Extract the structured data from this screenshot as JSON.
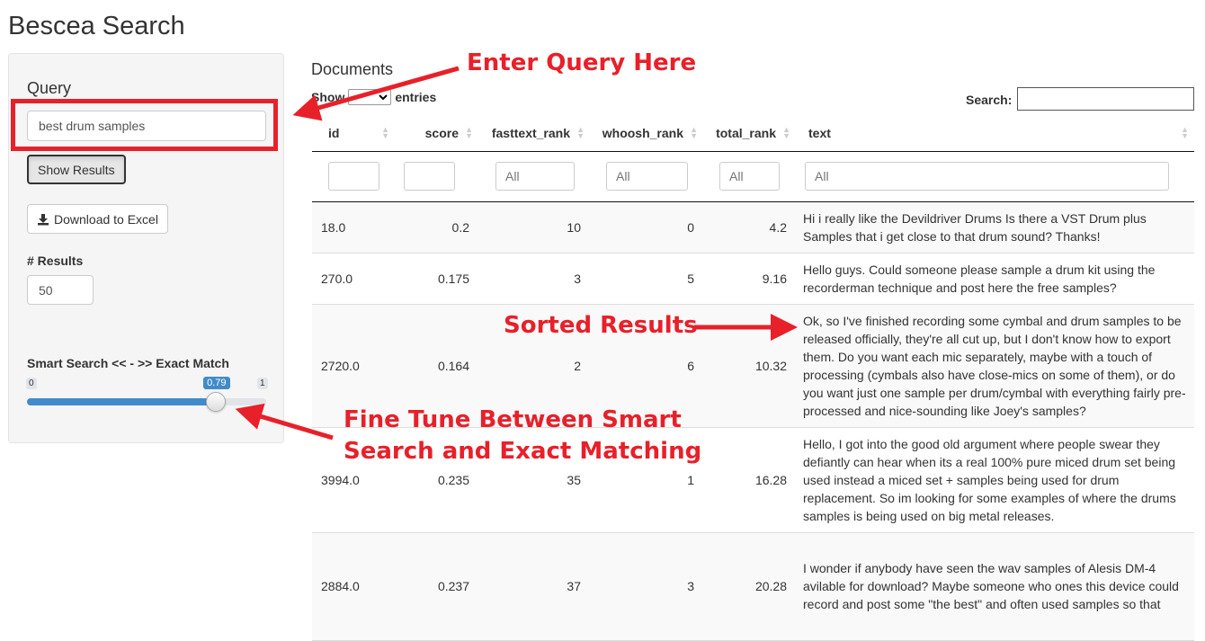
{
  "app": {
    "title": "Bescea Search"
  },
  "sidebar": {
    "query_label": "Query",
    "query_value": "best drum samples",
    "show_results_label": "Show Results",
    "download_label": "Download to Excel",
    "results_label": "# Results",
    "results_value": "50",
    "slider_label": "Smart Search << - >> Exact Match",
    "slider_min": "0",
    "slider_max": "1",
    "slider_value": "0.79",
    "slider_fraction": 0.79
  },
  "main": {
    "title": "Documents",
    "show_label": "Show",
    "entries_label": "entries",
    "search_label": "Search:",
    "columns": [
      "id",
      "score",
      "fasttext_rank",
      "whoosh_rank",
      "total_rank",
      "text"
    ],
    "filter_placeholder": "All",
    "rows": [
      {
        "id": "18.0",
        "score": "0.2",
        "fasttext_rank": "10",
        "whoosh_rank": "0",
        "total_rank": "4.2",
        "text": "Hi i really like the Devildriver Drums Is there a VST Drum plus Samples that i get close to that drum sound? Thanks!"
      },
      {
        "id": "270.0",
        "score": "0.175",
        "fasttext_rank": "3",
        "whoosh_rank": "5",
        "total_rank": "9.16",
        "text": "Hello guys. Could someone please sample a drum kit using the recorderman technique and post here the free samples?"
      },
      {
        "id": "2720.0",
        "score": "0.164",
        "fasttext_rank": "2",
        "whoosh_rank": "6",
        "total_rank": "10.32",
        "text": "Ok, so I've finished recording some cymbal and drum samples to be released officially, they're all cut up, but I don't know how to export them. Do you want each mic separately, maybe with a touch of processing (cymbals also have close-mics on some of them), or do you want just one sample per drum/cymbal with everything fairly pre-processed and nice-sounding like Joey's samples?"
      },
      {
        "id": "3994.0",
        "score": "0.235",
        "fasttext_rank": "35",
        "whoosh_rank": "1",
        "total_rank": "16.28",
        "text": "Hello, I got into the good old argument where people swear they defiantly can hear when its a real 100% pure miced drum set being used instead a miced set + samples being used for drum replacement. So im looking for some examples of where the drums samples is being used on big metal releases."
      },
      {
        "id": "2884.0",
        "score": "0.237",
        "fasttext_rank": "37",
        "whoosh_rank": "3",
        "total_rank": "20.28",
        "text": "I wonder if anybody have seen the wav samples of Alesis DM-4 avilable for download? Maybe someone who ones this device could record and post some \"the best\" and often used samples so that"
      }
    ]
  },
  "annotations": {
    "enter_query": "Enter Query Here",
    "sorted_results": "Sorted Results",
    "fine_tune_line1": "Fine Tune Between Smart",
    "fine_tune_line2": "Search and Exact Matching",
    "color": "#e8202a"
  }
}
